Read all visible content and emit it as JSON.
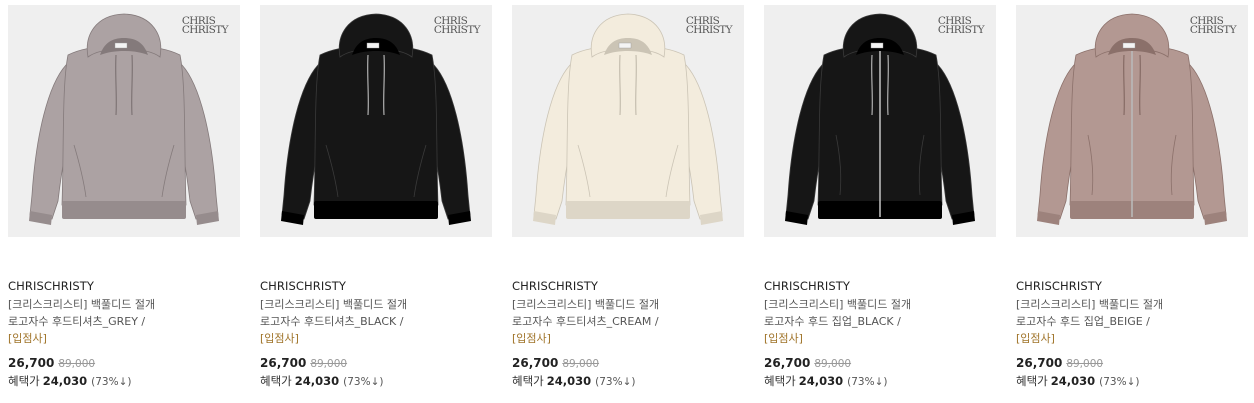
{
  "products": [
    {
      "brand_mark": [
        "CHRIS",
        "CHRISTY"
      ],
      "brand": "CHRISCHRISTY",
      "name_line1": "[크리스크리스티] 백풀디드 절개",
      "name_line2": "로고자수 후드티셔츠_GREY /",
      "tag": "[입점사]",
      "price": "26,700",
      "original_price": "89,000",
      "benefit_label": "혜택가",
      "benefit_price": "24,030",
      "discount_rate": "(73%↓)",
      "garment": {
        "style": "pullover",
        "color": "#aca2a3"
      }
    },
    {
      "brand_mark": [
        "CHRIS",
        "CHRISTY"
      ],
      "brand": "CHRISCHRISTY",
      "name_line1": "[크리스크리스티] 백풀디드 절개",
      "name_line2": "로고자수 후드티셔츠_BLACK /",
      "tag": "[입점사]",
      "price": "26,700",
      "original_price": "89,000",
      "benefit_label": "혜택가",
      "benefit_price": "24,030",
      "discount_rate": "(73%↓)",
      "garment": {
        "style": "pullover",
        "color": "#161616"
      }
    },
    {
      "brand_mark": [
        "CHRIS",
        "CHRISTY"
      ],
      "brand": "CHRISCHRISTY",
      "name_line1": "[크리스크리스티] 백풀디드 절개",
      "name_line2": "로고자수 후드티셔츠_CREAM /",
      "tag": "[입점사]",
      "price": "26,700",
      "original_price": "89,000",
      "benefit_label": "혜택가",
      "benefit_price": "24,030",
      "discount_rate": "(73%↓)",
      "garment": {
        "style": "pullover",
        "color": "#f3ecdd"
      }
    },
    {
      "brand_mark": [
        "CHRIS",
        "CHRISTY"
      ],
      "brand": "CHRISCHRISTY",
      "name_line1": "[크리스크리스티] 백풀디드 절개",
      "name_line2": "로고자수 후드 집업_BLACK /",
      "tag": "[입점사]",
      "price": "26,700",
      "original_price": "89,000",
      "benefit_label": "혜택가",
      "benefit_price": "24,030",
      "discount_rate": "(73%↓)",
      "garment": {
        "style": "zipup",
        "color": "#161616"
      }
    },
    {
      "brand_mark": [
        "CHRIS",
        "CHRISTY"
      ],
      "brand": "CHRISCHRISTY",
      "name_line1": "[크리스크리스티] 백풀디드 절개",
      "name_line2": "로고자수 후드 집업_BEIGE /",
      "tag": "[입점사]",
      "price": "26,700",
      "original_price": "89,000",
      "benefit_label": "혜택가",
      "benefit_price": "24,030",
      "discount_rate": "(73%↓)",
      "garment": {
        "style": "zipup",
        "color": "#b39892"
      }
    }
  ]
}
